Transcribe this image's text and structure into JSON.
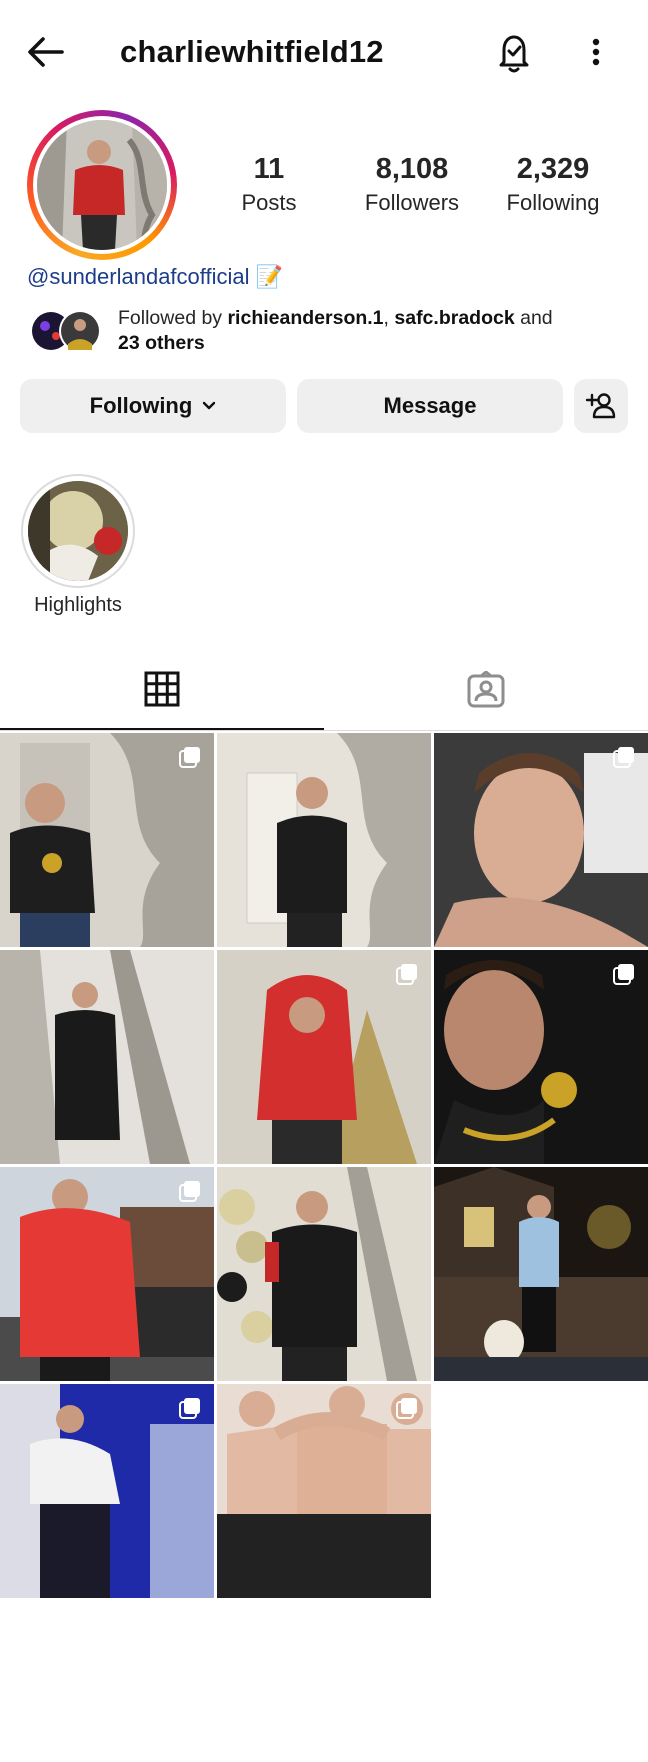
{
  "header": {
    "username": "charliewhitfield12",
    "icons": [
      "back-arrow-icon",
      "notification-bell-icon",
      "more-options-icon"
    ]
  },
  "profile": {
    "stats": [
      {
        "value": "11",
        "label": "Posts"
      },
      {
        "value": "8,108",
        "label": "Followers"
      },
      {
        "value": "2,329",
        "label": "Following"
      }
    ],
    "bio_link": "@sunderlandafcofficial",
    "bio_emoji": "📝",
    "followed_by": {
      "prefix": "Followed by ",
      "user1": "richieanderson.1",
      "separator": ", ",
      "user2": "safc.bradock",
      "and": " and",
      "others": "23 others"
    }
  },
  "actions": {
    "following_label": "Following",
    "message_label": "Message"
  },
  "highlights": [
    {
      "label": "Highlights"
    }
  ],
  "tabs": [
    "posts-grid-icon",
    "tagged-icon"
  ],
  "posts": [
    {
      "multi": true
    },
    {
      "multi": false
    },
    {
      "multi": true
    },
    {
      "multi": false
    },
    {
      "multi": true
    },
    {
      "multi": true
    },
    {
      "multi": true
    },
    {
      "multi": false
    },
    {
      "multi": false
    },
    {
      "multi": true
    },
    {
      "multi": true
    }
  ],
  "colors": {
    "link": "#1c3d8a",
    "button_bg": "#efefef",
    "story_ring": [
      "#f9a825",
      "#ff5722",
      "#d81b60",
      "#8e24aa"
    ]
  }
}
